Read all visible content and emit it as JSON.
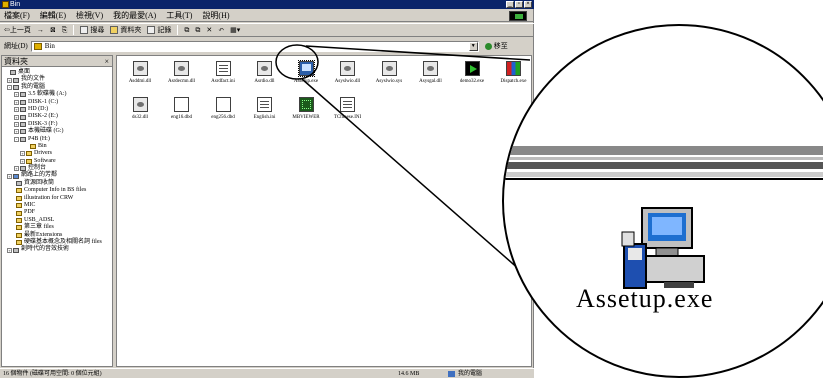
{
  "window": {
    "title": "Bin",
    "minimize_glyph": "_",
    "restore_glyph": "▫",
    "close_glyph": "×"
  },
  "menu": [
    "檔案(F)",
    "編輯(E)",
    "檢視(V)",
    "我的最愛(A)",
    "工具(T)",
    "說明(H)"
  ],
  "toolbar": {
    "back": "上一頁",
    "search": "搜尋",
    "folders": "資料夾",
    "history": "記錄"
  },
  "address": {
    "label": "網址(D)",
    "value": "Bin",
    "go": "移至"
  },
  "left_pane": {
    "title": "資料夾",
    "close_glyph": "×",
    "tree": [
      {
        "label": "桌面",
        "expander": ""
      },
      {
        "label": "我的文件",
        "expander": "+"
      },
      {
        "label": "我的電腦",
        "expander": "-"
      },
      {
        "label": "3.5 軟碟機 (A:)",
        "expander": "+"
      },
      {
        "label": "DISK-1 (C:)",
        "expander": "+"
      },
      {
        "label": "HD (D:)",
        "expander": "+"
      },
      {
        "label": "DISK-2 (E:)",
        "expander": "+"
      },
      {
        "label": "DISK-3 (F:)",
        "expander": "+"
      },
      {
        "label": "本機磁碟 (G:)",
        "expander": "+"
      },
      {
        "label": "P4B (H:)",
        "expander": "-"
      },
      {
        "label": "Bin",
        "expander": ""
      },
      {
        "label": "Drivers",
        "expander": "+"
      },
      {
        "label": "Software",
        "expander": "+"
      },
      {
        "label": "控制台",
        "expander": "+"
      },
      {
        "label": "網路上的芳鄰",
        "expander": "+"
      },
      {
        "label": "資源回收筒",
        "expander": ""
      },
      {
        "label": "Computer Info in BS files",
        "expander": ""
      },
      {
        "label": "illustration for CRW",
        "expander": ""
      },
      {
        "label": "MIC",
        "expander": ""
      },
      {
        "label": "PDF",
        "expander": ""
      },
      {
        "label": "USB_ADSL",
        "expander": ""
      },
      {
        "label": "第三章 files",
        "expander": ""
      },
      {
        "label": "最新Extensions",
        "expander": ""
      },
      {
        "label": "硬碟基本概念及相關名詞 files",
        "expander": ""
      },
      {
        "label": "創時代的音效技術",
        "expander": "+"
      }
    ]
  },
  "files": [
    {
      "name": "Asddmi.dll",
      "icon": "dll"
    },
    {
      "name": "Asrdecmn.dll",
      "icon": "dll"
    },
    {
      "name": "Asrdfact.ini",
      "icon": "ini"
    },
    {
      "name": "Asrdio.dll",
      "icon": "dll"
    },
    {
      "name": "Assetup.exe",
      "icon": "exe"
    },
    {
      "name": "Asyslwio.dll",
      "icon": "dll"
    },
    {
      "name": "Asyslwio.sys",
      "icon": "dll"
    },
    {
      "name": "Asysgal.dll",
      "icon": "dll"
    },
    {
      "name": "demo32.exe",
      "icon": "play"
    },
    {
      "name": "Dispatch.exe",
      "icon": "color"
    },
    {
      "name": "ds32.dll",
      "icon": "dll"
    },
    {
      "name": "eng16.dbd",
      "icon": "doc"
    },
    {
      "name": "eng256.dbd",
      "icon": "doc"
    },
    {
      "name": "English.ini",
      "icon": "ini"
    },
    {
      "name": "MBVIEWER",
      "icon": "grid"
    },
    {
      "name": "TChinese.INI",
      "icon": "ini"
    }
  ],
  "status": {
    "objects": "16 個物件 (磁碟可用空間: 0 個位元組)",
    "size": "14.6 MB",
    "location": "我的電腦"
  },
  "magnified": {
    "filename": "Assetup.exe"
  }
}
